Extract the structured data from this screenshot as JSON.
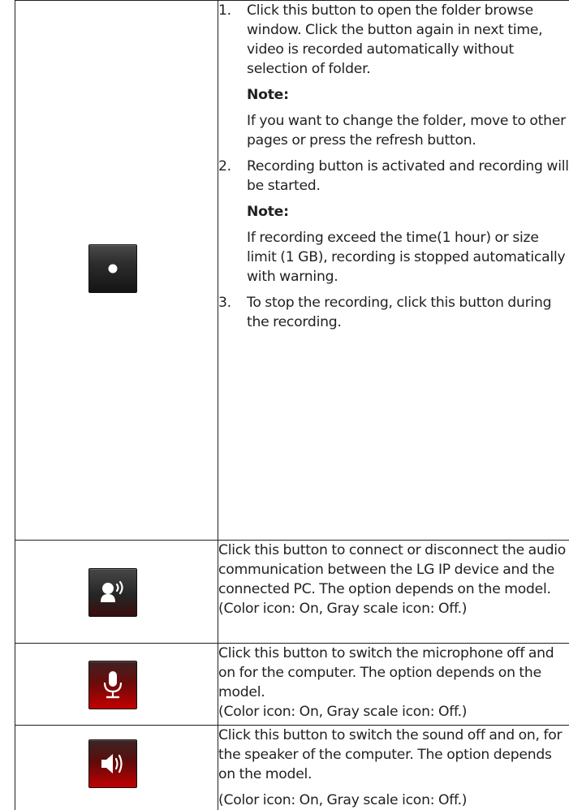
{
  "rows": [
    {
      "icon": "record-icon",
      "steps": [
        {
          "num": "1.",
          "text": "Click this button to open the folder browse window. Click the button again in next time, video is recorded automatically without selection of folder.",
          "note_label": "Note:",
          "note_text": "If you want to change the folder, move to other pages or press the refresh button."
        },
        {
          "num": "2.",
          "text": "Recording button is activated and recording will be started.",
          "note_label": "Note:",
          "note_text": "If recording exceed the time(1 hour) or size limit (1 GB), recording is stopped automatically with warning."
        },
        {
          "num": "3.",
          "text": "To stop the recording, click this button during the recording."
        }
      ]
    },
    {
      "icon": "audio-communication-icon",
      "text": "Click this button to connect or disconnect the audio communication between the LG IP device and the connected PC. The option depends on the model.",
      "status": "(Color icon: On, Gray scale icon: Off.)"
    },
    {
      "icon": "microphone-icon",
      "text": "Click this button to switch the microphone off and on for the computer. The option depends on the model.",
      "status": "(Color icon: On, Gray scale icon: Off.)"
    },
    {
      "icon": "speaker-icon",
      "text": "Click this button to switch the sound off and on, for the speaker of the computer. The option depends on the model.",
      "status": "(Color icon: On, Gray scale icon: Off.)"
    }
  ]
}
